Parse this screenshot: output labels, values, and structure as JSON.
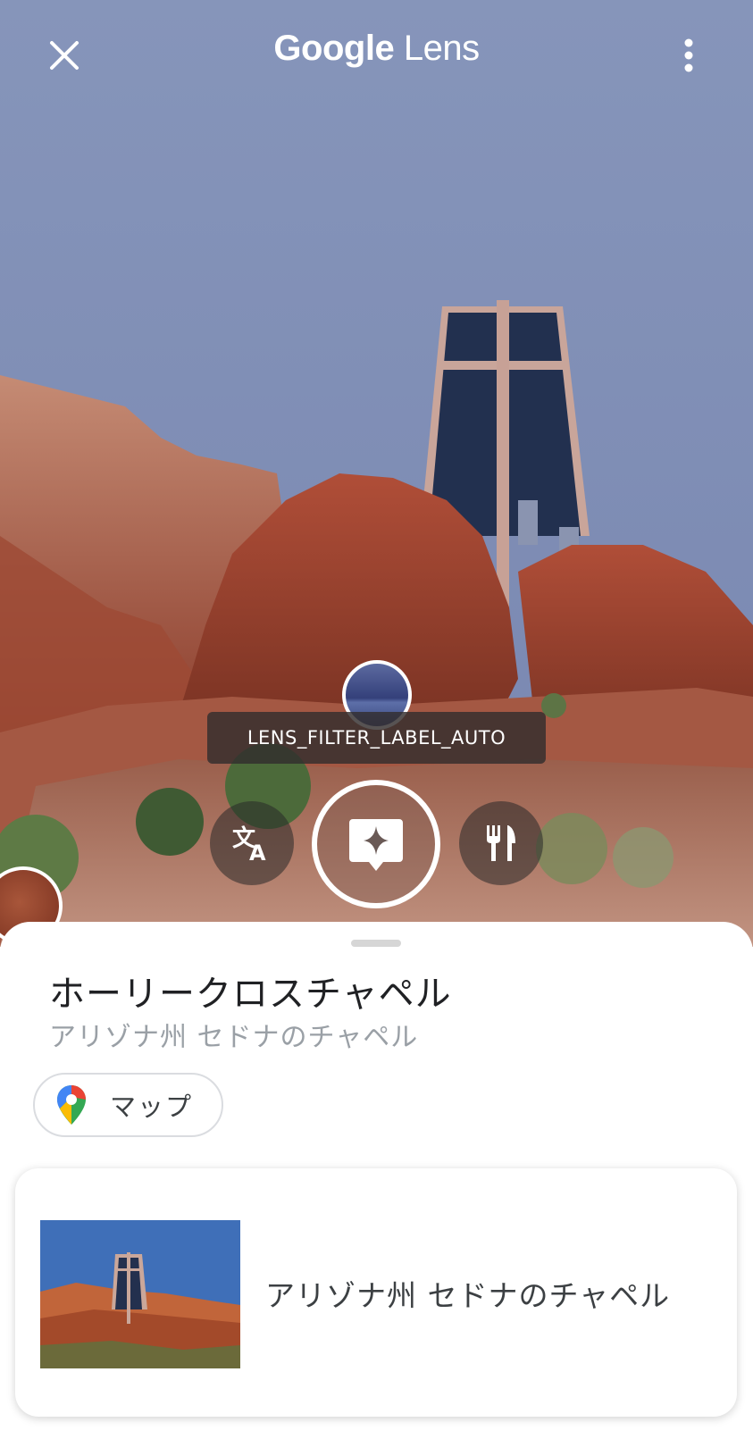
{
  "header": {
    "title_google": "Google",
    "title_lens": "Lens",
    "close_icon": "close-icon",
    "menu_icon": "more-vert-icon"
  },
  "filter": {
    "label": "LENS_FILTER_LABEL_AUTO"
  },
  "modes": {
    "translate_icon": "translate-icon",
    "search_icon": "lens-search-icon",
    "dining_icon": "restaurant-icon"
  },
  "result": {
    "title": "ホーリークロスチャペル",
    "subtitle": "アリゾナ州 セドナのチャペル",
    "maps_chip_label": "マップ",
    "card_text": "アリゾナ州 セドナのチャペル"
  },
  "colors": {
    "sky": "#8594b8",
    "rock": "#a4503a",
    "text_primary": "#202124",
    "text_secondary": "#9aa0a6"
  }
}
